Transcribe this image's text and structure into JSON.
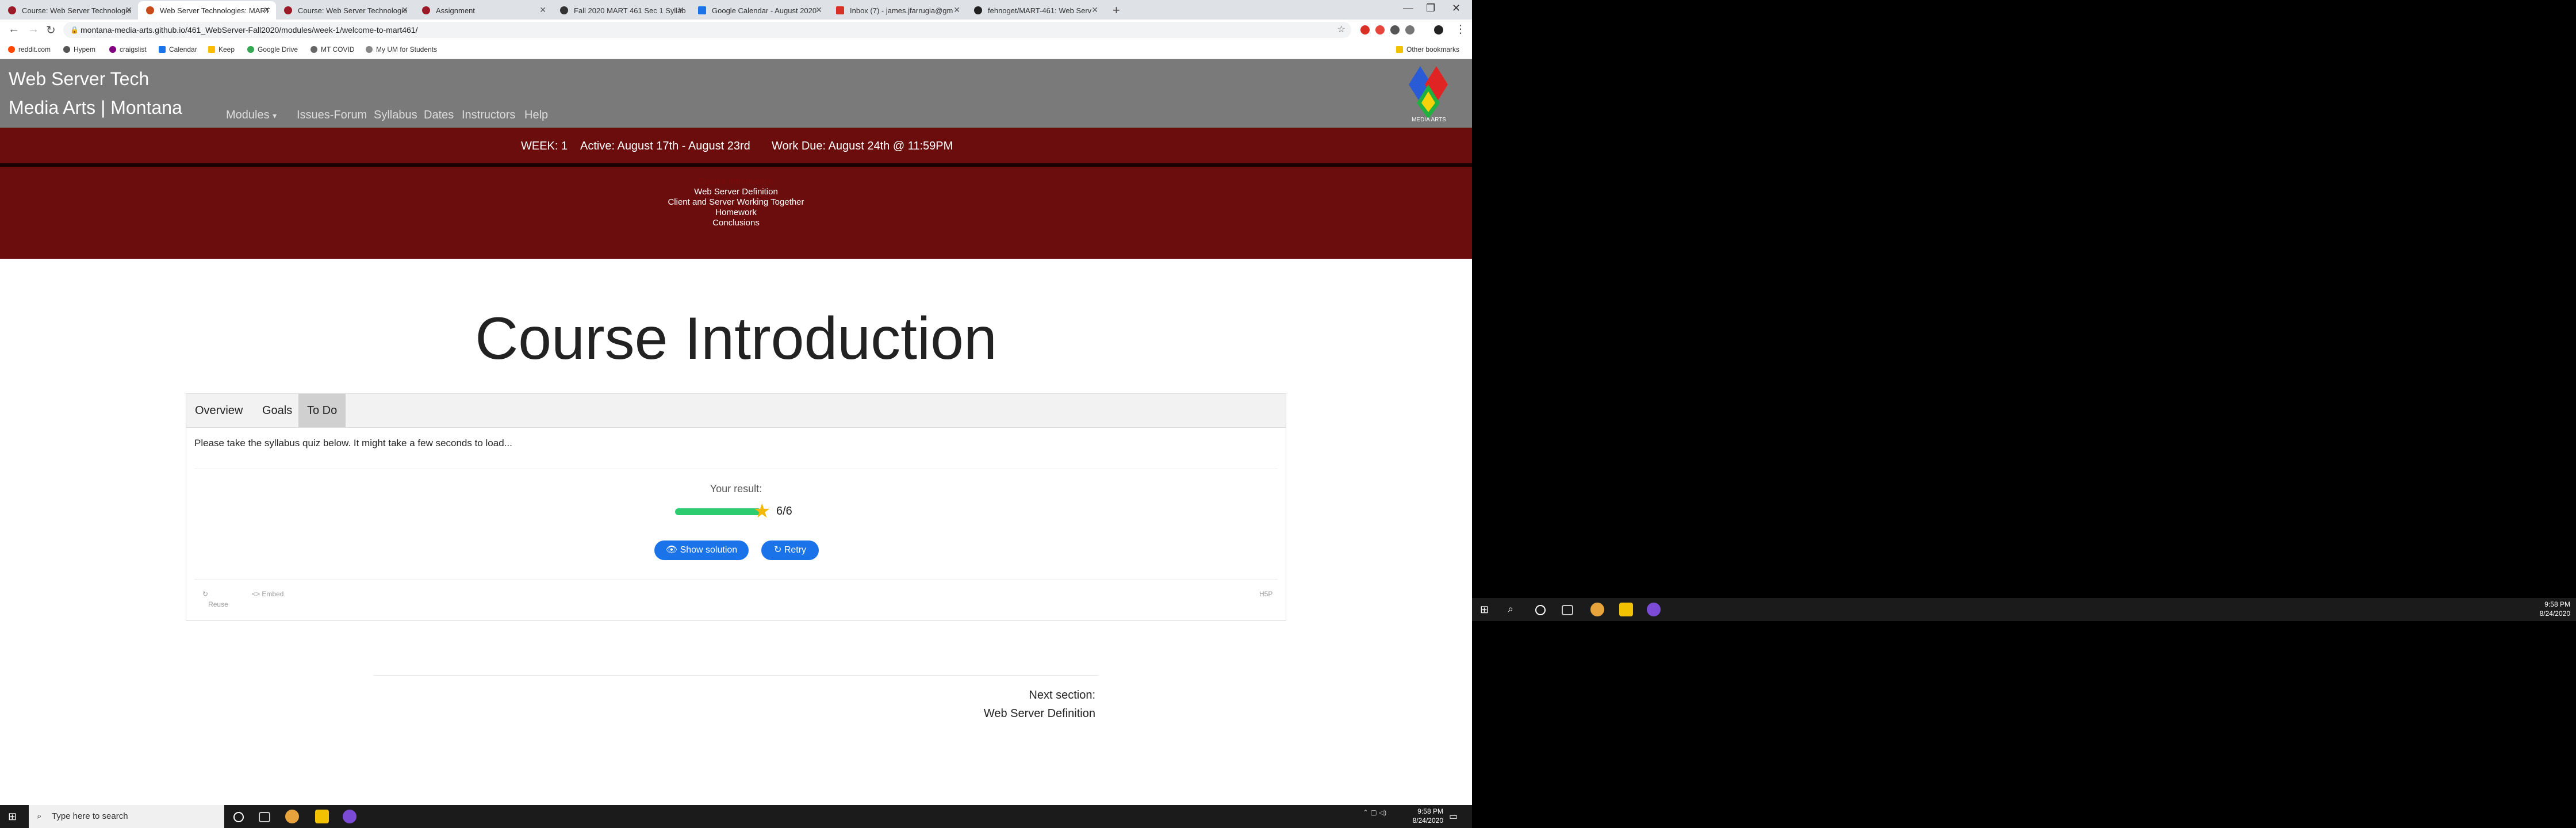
{
  "browser": {
    "tabs": [
      {
        "title": "Course: Web Server Technologie",
        "active": false
      },
      {
        "title": "Web Server Technologies: MART",
        "active": true
      },
      {
        "title": "Course: Web Server Technologie",
        "active": false
      },
      {
        "title": "Assignment",
        "active": false
      },
      {
        "title": "Fall 2020 MART 461 Sec 1 Syllab",
        "active": false
      },
      {
        "title": "Google Calendar - August 2020",
        "active": false
      },
      {
        "title": "Inbox (7) - james.jfarrugia@gm",
        "active": false
      },
      {
        "title": "fehnoget/MART-461: Web Serv",
        "active": false
      }
    ],
    "new_tab": "+",
    "url": "montana-media-arts.github.io/461_WebServer-Fall2020/modules/week-1/welcome-to-mart461/",
    "bookmarks": [
      "reddit.com",
      "Hypem",
      "craigslist",
      "Calendar",
      "Keep",
      "Google Drive",
      "MT COVID",
      "My UM for Students"
    ],
    "other_bookmarks": "Other bookmarks"
  },
  "site": {
    "brand_line1": "Web Server Tech",
    "brand_line2": "Media Arts | Montana",
    "nav": [
      "Modules",
      "Issues-Forum",
      "Syllabus",
      "Dates",
      "Instructors",
      "Help"
    ],
    "modules_caret": "▾",
    "week": {
      "label": "WEEK: 1",
      "active": "Active: August 17th - August 23rd",
      "due": "Work Due: August 24th @ 11:59PM"
    },
    "submenu": [
      "Course Introduction",
      "Web Server Definition",
      "Client and Server Working Together",
      "Homework",
      "Conclusions"
    ],
    "logo_text": "MEDIA ARTS"
  },
  "page": {
    "title": "Course Introduction",
    "tabs": [
      "Overview",
      "Goals",
      "To Do"
    ],
    "active_tab": "To Do",
    "intro": "Please take the syllabus quiz below. It might take a few seconds to load...",
    "quiz": {
      "result_label": "Your result:",
      "score": "6/6",
      "progress_fraction": 1.0,
      "show_solution": "Show solution",
      "retry": "Retry",
      "reuse": "Reuse",
      "embed": "<> Embed",
      "h5p": "H5P"
    },
    "next_section_label": "Next section:",
    "next_section_title": "Web Server Definition"
  },
  "taskbar": {
    "search_placeholder": "Type here to search",
    "time": "9:58 PM",
    "date": "8/24/2020"
  },
  "colors": {
    "header_gray": "#7a7a7a",
    "maroon": "#6b0d0d",
    "button_blue": "#1a73e8",
    "progress_green": "#2ecc71",
    "star": "#f5b800"
  }
}
